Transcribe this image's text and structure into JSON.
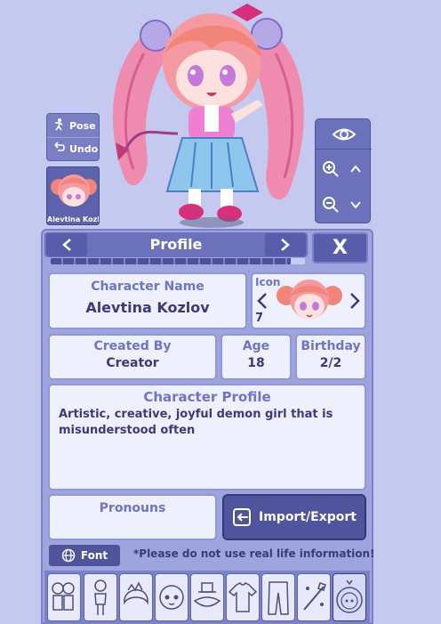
{
  "toolbar": {
    "pose_label": "Pose",
    "undo_label": "Undo"
  },
  "character": {
    "thumb_name": "Alevtina Kozlo"
  },
  "panel": {
    "title": "Profile",
    "close_label": "X",
    "progress_fraction": 0.95
  },
  "profile": {
    "name_label": "Character Name",
    "name_value": "Alevtina Kozlov",
    "icon_label": "Icon",
    "icon_number": "7",
    "created_by_label": "Created By",
    "created_by_value": "Creator",
    "age_label": "Age",
    "age_value": "18",
    "birthday_label": "Birthday",
    "birthday_value": "2/2",
    "profile_label": "Character Profile",
    "profile_text": "Artistic, creative, joyful demon girl that is misunderstood often",
    "pronouns_label": "Pronouns",
    "pronouns_value": ""
  },
  "actions": {
    "import_export_label": "Import/Export",
    "font_label": "Font"
  },
  "warning": "*Please do not use real life information!",
  "tabs": [
    {
      "icon": "group-preset-icon"
    },
    {
      "icon": "body-icon"
    },
    {
      "icon": "hair-icon"
    },
    {
      "icon": "face-icon"
    },
    {
      "icon": "hat-icon"
    },
    {
      "icon": "shirt-icon"
    },
    {
      "icon": "pants-icon"
    },
    {
      "icon": "props-icon"
    },
    {
      "icon": "profile-tab-icon"
    }
  ],
  "colors": {
    "background": "#c5c9ef",
    "panel": "#9ea4de",
    "accent": "#4f549d",
    "label": "#6f74c3"
  }
}
